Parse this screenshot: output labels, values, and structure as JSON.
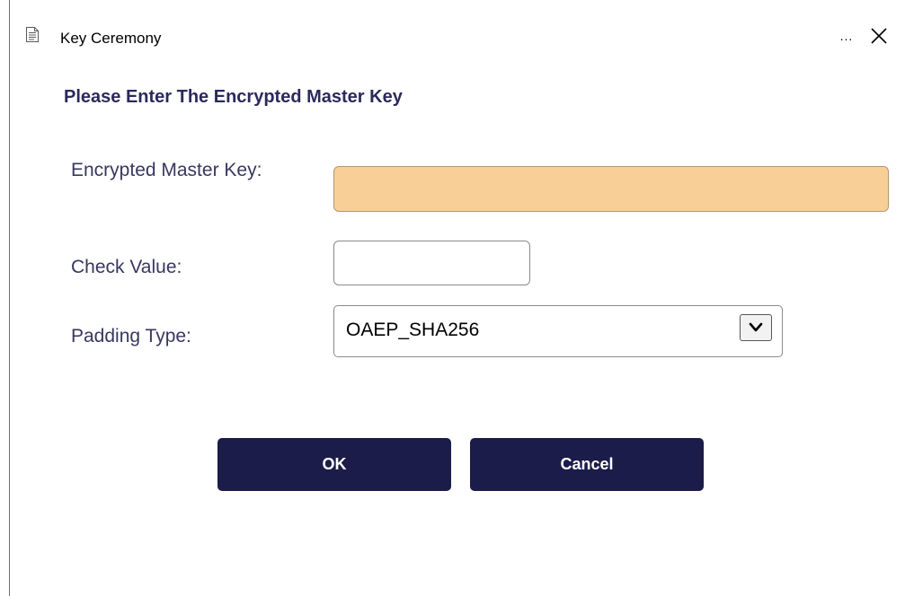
{
  "window": {
    "title": "Key Ceremony",
    "more_label": "...",
    "app_icon": "document-icon",
    "close_icon": "close-icon"
  },
  "form": {
    "heading": "Please Enter The Encrypted Master Key",
    "encrypted_master_key": {
      "label": "Encrypted Master Key:",
      "value": "",
      "highlight_color": "#f8cf96"
    },
    "check_value": {
      "label": "Check Value:",
      "value": ""
    },
    "padding_type": {
      "label": "Padding Type:",
      "selected": "OAEP_SHA256",
      "dropdown_icon": "chevron-down-icon"
    }
  },
  "buttons": {
    "ok_label": "OK",
    "cancel_label": "Cancel",
    "color": "#1b1c49"
  }
}
